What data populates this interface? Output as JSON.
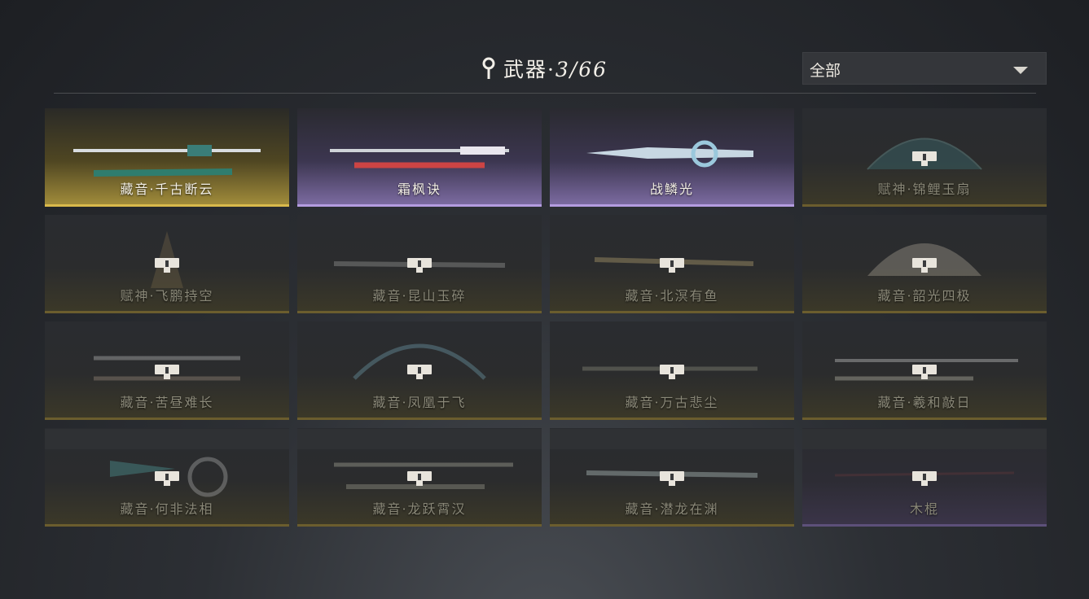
{
  "header": {
    "icon": "location-pin-icon",
    "title": "武器",
    "separator": "·",
    "count": "3/66"
  },
  "filter": {
    "selected": "全部",
    "icon": "chevron-down-icon"
  },
  "weapons": [
    {
      "name": "藏音·千古断云",
      "locked": false,
      "rarity": "gold"
    },
    {
      "name": "霜枫诀",
      "locked": false,
      "rarity": "purple"
    },
    {
      "name": "战鳞光",
      "locked": false,
      "rarity": "purple"
    },
    {
      "name": "赋神·锦鲤玉扇",
      "locked": true,
      "rarity": "gold"
    },
    {
      "name": "赋神·飞鹏持空",
      "locked": true,
      "rarity": "gold"
    },
    {
      "name": "藏音·昆山玉碎",
      "locked": true,
      "rarity": "gold"
    },
    {
      "name": "藏音·北溟有鱼",
      "locked": true,
      "rarity": "gold"
    },
    {
      "name": "藏音·韶光四极",
      "locked": true,
      "rarity": "gold"
    },
    {
      "name": "藏音·苦昼难长",
      "locked": true,
      "rarity": "gold"
    },
    {
      "name": "藏音·凤凰于飞",
      "locked": true,
      "rarity": "gold"
    },
    {
      "name": "藏音·万古悲尘",
      "locked": true,
      "rarity": "gold"
    },
    {
      "name": "藏音·羲和敲日",
      "locked": true,
      "rarity": "gold"
    },
    {
      "name": "藏音·何非法相",
      "locked": true,
      "rarity": "gold"
    },
    {
      "name": "藏音·龙跃霄汉",
      "locked": true,
      "rarity": "gold"
    },
    {
      "name": "藏音·潜龙在渊",
      "locked": true,
      "rarity": "gold"
    },
    {
      "name": "木棍",
      "locked": true,
      "rarity": "purple"
    }
  ],
  "colors": {
    "gold_accent": "#d9b94b",
    "purple_accent": "#b49ce0",
    "background": "#2c2f34"
  }
}
